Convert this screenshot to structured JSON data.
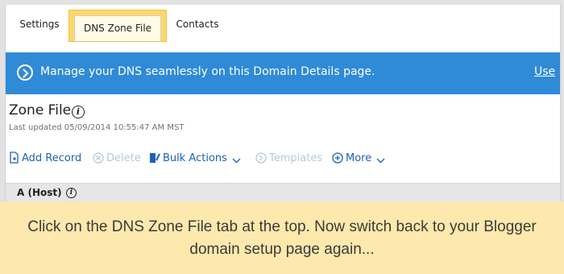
{
  "tabs": {
    "settings": "Settings",
    "dns_zone_file": "DNS Zone File",
    "contacts": "Contacts"
  },
  "banner": {
    "text": "Manage your DNS seamlessly on this Domain Details page.",
    "link": "Use",
    "color": "#2f8ad8"
  },
  "zone": {
    "title": "Zone File",
    "last_updated": "Last updated 05/09/2014 10:55:47 AM MST"
  },
  "toolbar": {
    "add_record": "Add Record",
    "delete": "Delete",
    "bulk_actions": "Bulk Actions",
    "templates": "Templates",
    "more": "More"
  },
  "section": {
    "label": "A (Host)"
  },
  "caption": {
    "text": "Click on the DNS Zone File tab at the top. Now switch back to your Blogger domain setup page again..."
  },
  "icons": [
    "arrow-circle-icon",
    "info-icon",
    "add-document-icon",
    "delete-circle-icon",
    "bulk-edit-icon",
    "chevron-down-icon",
    "templates-circle-icon",
    "plus-circle-icon"
  ],
  "colors": {
    "highlight_tab": "#fcd86a",
    "link_blue": "#1d62b7",
    "caption_bg": "#fde9ad"
  }
}
